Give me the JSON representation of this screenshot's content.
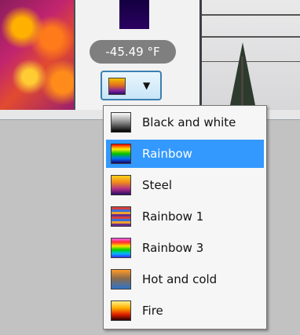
{
  "header": {
    "temperature_readout": "-45.49 °F"
  },
  "palette_dropdown": {
    "selected_label": "Rainbow",
    "items": [
      {
        "label": "Black and white",
        "icon": "palette-black-and-white-icon"
      },
      {
        "label": "Rainbow",
        "icon": "palette-rainbow-icon"
      },
      {
        "label": "Steel",
        "icon": "palette-steel-icon"
      },
      {
        "label": "Rainbow 1",
        "icon": "palette-rainbow-1-icon"
      },
      {
        "label": "Rainbow 3",
        "icon": "palette-rainbow-3-icon"
      },
      {
        "label": "Hot and cold",
        "icon": "palette-hot-and-cold-icon"
      },
      {
        "label": "Fire",
        "icon": "palette-fire-icon"
      }
    ]
  },
  "colors": {
    "selection_highlight": "#3399ff",
    "button_border": "#3c7fb1",
    "pill_background": "#7f7f7f"
  }
}
